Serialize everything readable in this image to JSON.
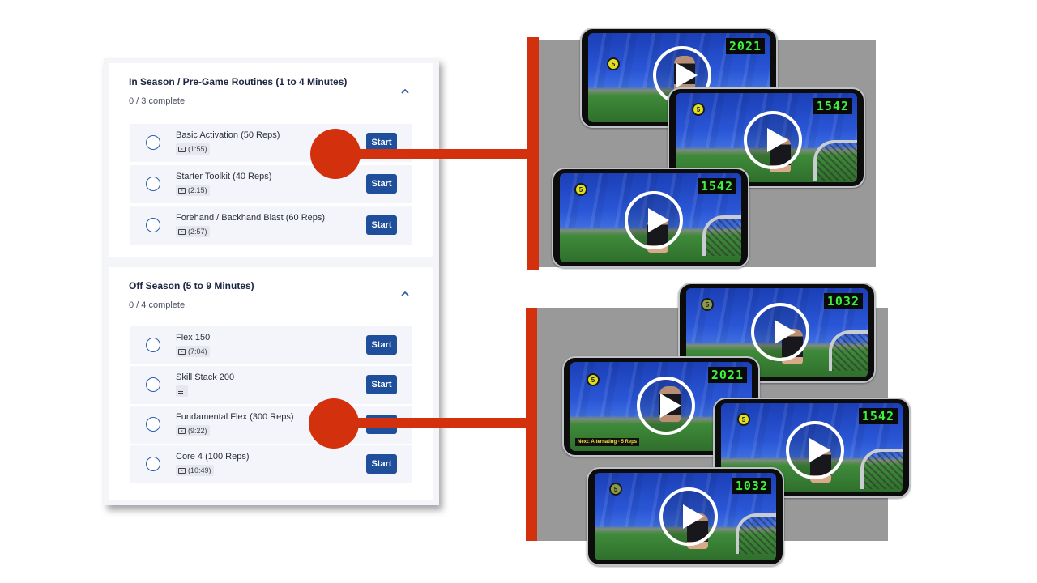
{
  "sections": [
    {
      "title": "In Season / Pre-Game Routines (1 to 4 Minutes)",
      "progress": "0 / 3 complete",
      "lessons": [
        {
          "title": "Basic Activation (50 Reps)",
          "meta": "(1:55)",
          "icon": "video-icon",
          "button": "Start"
        },
        {
          "title": "Starter Toolkit (40 Reps)",
          "meta": "(2:15)",
          "icon": "video-icon",
          "button": "Start"
        },
        {
          "title": "Forehand / Backhand Blast (60 Reps)",
          "meta": "(2:57)",
          "icon": "video-icon",
          "button": "Start"
        }
      ]
    },
    {
      "title": "Off Season (5 to 9 Minutes)",
      "progress": "0 / 4 complete",
      "lessons": [
        {
          "title": "Flex 150",
          "meta": "(7:04)",
          "icon": "video-icon",
          "button": "Start"
        },
        {
          "title": "Skill Stack 200",
          "meta": "",
          "icon": "text-icon",
          "button": "Start"
        },
        {
          "title": "Fundamental Flex (300 Reps)",
          "meta": "(9:22)",
          "icon": "video-icon",
          "button": "Start"
        },
        {
          "title": "Core 4 (100 Reps)",
          "meta": "(10:49)",
          "icon": "video-icon",
          "button": "Start"
        }
      ]
    }
  ],
  "videos": [
    {
      "target": "5",
      "timer": "2021",
      "next": ""
    },
    {
      "target": "5",
      "timer": "1542",
      "next": ""
    },
    {
      "target": "5",
      "timer": "1542",
      "next": ""
    },
    {
      "target": "5",
      "timer": "1032",
      "next": ""
    },
    {
      "target": "5",
      "timer": "2021",
      "next": "Next: Alternating - 5 Reps"
    },
    {
      "target": "5",
      "timer": "1542",
      "next": ""
    },
    {
      "target": "5",
      "timer": "1032",
      "next": ""
    }
  ],
  "colors": {
    "accent": "#d3300d",
    "button": "#1f4e9a",
    "radio": "#2f5fa8"
  }
}
